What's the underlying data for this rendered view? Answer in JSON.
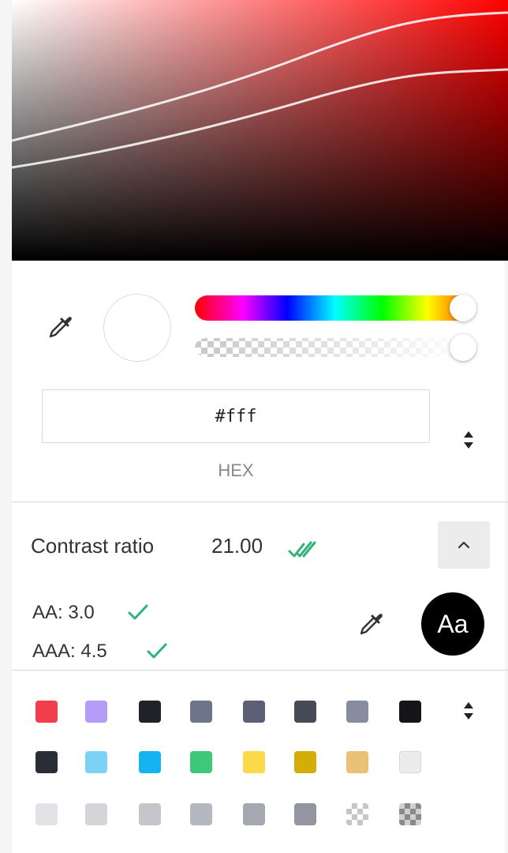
{
  "picker": {
    "hue_color": "#ff0000",
    "selected_color": "#ffffff",
    "hue_position": 1.0,
    "alpha_position": 1.0,
    "hex": {
      "value": "#fff",
      "label": "HEX"
    }
  },
  "contrast": {
    "title": "Contrast ratio",
    "ratio": "21.00",
    "status_color": "#2eb37a",
    "aa_label": "AA: 3.0",
    "aaa_label": "AAA: 4.5",
    "sample_text": "Aa",
    "sample_bg": "#000000",
    "sample_fg": "#ffffff"
  },
  "palette": {
    "rows": [
      [
        "#f23d4a",
        "#b69cf7",
        "#1f2226",
        "#6e7489",
        "#5c6076",
        "#474b58",
        "#878ca1",
        "#141518"
      ],
      [
        "#2a2d36",
        "#7bd2f5",
        "#15b3ef",
        "#3ec87a",
        "#fcd94a",
        "#d5ad09",
        "#ebc077",
        "#ececec"
      ],
      [
        "#e2e3e6",
        "#d4d5d9",
        "#c4c6cc",
        "#b4b7bf",
        "#a5a8b1",
        "#9396a1",
        "checker-light",
        "checker-dark"
      ]
    ]
  },
  "icons": {
    "eyedropper": "eyedropper-icon",
    "format_toggle": "up-down-arrows-icon",
    "collapse": "chevron-up-icon",
    "double_check": "double-check-icon",
    "check": "check-icon"
  }
}
